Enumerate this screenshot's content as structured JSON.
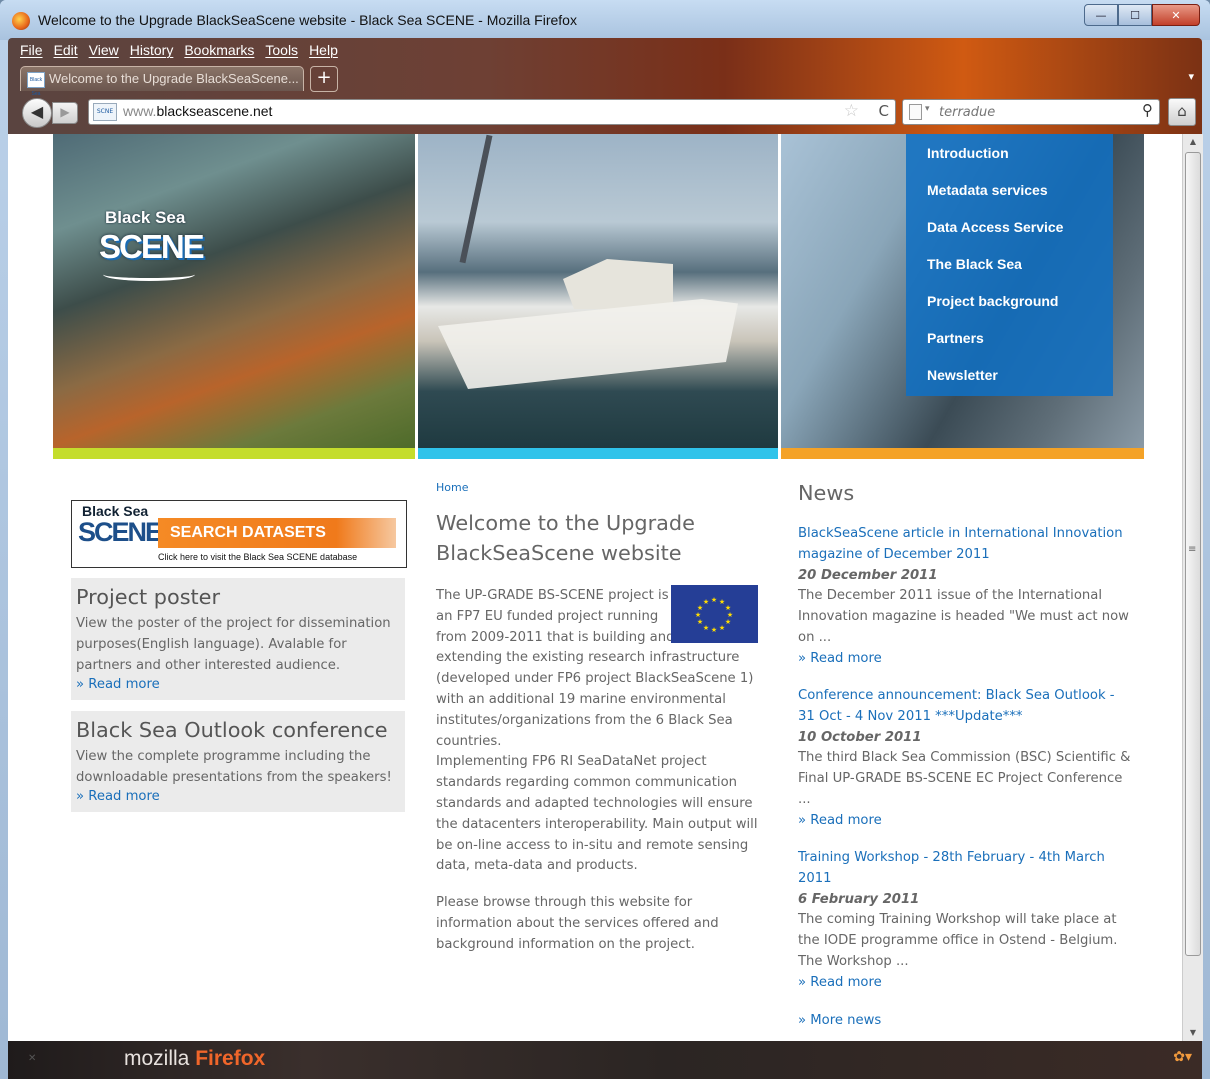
{
  "window": {
    "title": "Welcome to the Upgrade BlackSeaScene website - Black Sea SCENE - Mozilla Firefox",
    "buttons": {
      "minimize": "—",
      "maximize": "☐",
      "close": "✕"
    }
  },
  "menubar": [
    "File",
    "Edit",
    "View",
    "History",
    "Bookmarks",
    "Tools",
    "Help"
  ],
  "tab": {
    "label": "Welcome to the Upgrade BlackSeaScene...",
    "favicon": "Black Sea SCENE",
    "new_tab": "+"
  },
  "navbar": {
    "back": "◀",
    "forward": "▶",
    "url_prefix": "www.",
    "url_domain": "blackseascene.net",
    "search_placeholder": "terradue",
    "star": "☆",
    "reload": "C",
    "home": "⌂",
    "search_icon": "⚲"
  },
  "site": {
    "logo_line1": "Black Sea",
    "logo_line2": "SCENE",
    "colors": {
      "nav_bg": "#1170c2",
      "link": "#1a6fba",
      "bar1": "#c4dd2c",
      "bar2": "#2fc3ea",
      "bar3": "#f4a227"
    },
    "nav": [
      "Introduction",
      "Metadata services",
      "Data Access Service",
      "The Black Sea",
      "Project background",
      "Partners",
      "Newsletter"
    ]
  },
  "left": {
    "search_banner": {
      "logo1": "Black Sea",
      "logo2": "SCENE",
      "button": "SEARCH DATASETS",
      "sub": "Click here to visit the Black Sea SCENE database"
    },
    "boxes": [
      {
        "title": "Project poster",
        "text": "View the poster of the project for dissemination purposes(English language). Avalable for partners and other interested audience.",
        "more": "» Read more"
      },
      {
        "title": "Black Sea Outlook conference",
        "text": "View the complete programme including the downloadable presentations from the speakers!",
        "more": "» Read more"
      }
    ]
  },
  "main": {
    "breadcrumb": "Home",
    "title": "Welcome to the Upgrade BlackSeaScene website",
    "para1": "The UP-GRADE BS-SCENE project is an FP7 EU funded project running from 2009-2011 that is building and extending the existing research infrastructure (developed under FP6 project BlackSeaScene 1) with an additional 19 marine environmental institutes/organizations from the 6 Black Sea countries.",
    "para2": "Implementing FP6 RI SeaDataNet project standards regarding common communication standards and adapted technologies  will ensure the datacenters interoperability. Main output will be on-line access to in-situ and remote sensing data, meta-data and products.",
    "para3": "Please browse through this website for information about the services offered and background information on the project."
  },
  "news": {
    "heading": "News",
    "items": [
      {
        "title": "BlackSeaScene article in International Innovation magazine of December 2011",
        "date": "20 December 2011",
        "summary": "The December 2011 issue of the International Innovation magazine is headed \"We must act now on ...",
        "more": "» Read more"
      },
      {
        "title": "Conference announcement: Black Sea Outlook - 31 Oct - 4 Nov 2011 ***Update***",
        "date": "10 October 2011",
        "summary": "The third Black Sea Commission (BSC) Scientific & Final UP-GRADE BS-SCENE EC Project Conference ...",
        "more": "» Read more"
      },
      {
        "title": "Training Workshop - 28th February - 4th March 2011",
        "date": "6 February 2011",
        "summary": "The coming Training Workshop will take place at the IODE programme office in Ostend - Belgium. The Workshop ...",
        "more": "» Read more"
      }
    ],
    "more_news": "» More news"
  },
  "statusbar": {
    "brand1": "mozilla",
    "brand2": "Firefox"
  }
}
